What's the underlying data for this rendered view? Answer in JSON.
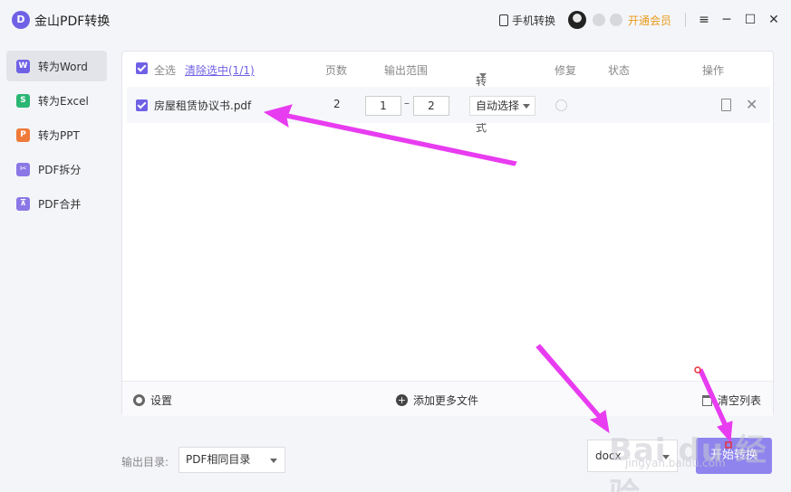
{
  "window": {
    "logo_letter": "D",
    "title": "金山PDF转换",
    "phone_convert": "手机转换",
    "vip_label": "开通会员",
    "menu_icon": "≡",
    "minimize_icon": "─",
    "maximize_icon": "☐",
    "close_icon": "✕"
  },
  "sidebar": {
    "items": [
      {
        "label": "转为Word",
        "icon": "W",
        "color": "#6f61e6",
        "active": true
      },
      {
        "label": "转为Excel",
        "icon": "S",
        "color": "#2bb673",
        "active": false
      },
      {
        "label": "转为PPT",
        "icon": "P",
        "color": "#f07a3a",
        "active": false
      },
      {
        "label": "PDF拆分",
        "icon": "✂",
        "color": "#8b78e6",
        "active": false
      },
      {
        "label": "PDF合并",
        "icon": "⊼",
        "color": "#8b78e6",
        "active": false
      }
    ]
  },
  "table": {
    "headers": {
      "select_all": "全选",
      "clear_selected": "清除选中(1/1)",
      "pages": "页数",
      "range": "输出范围",
      "mode": "转换模式",
      "repair": "修复",
      "status": "状态",
      "actions": "操作"
    },
    "rows": [
      {
        "filename": "房屋租赁协议书.pdf",
        "pages": "2",
        "range_from": "1",
        "range_sep": "–",
        "range_to": "2",
        "mode": "自动选择"
      }
    ]
  },
  "footer": {
    "settings": "设置",
    "add_more": "添加更多文件",
    "clear_list": "清空列表"
  },
  "bottom": {
    "output_dir_label": "输出目录:",
    "output_dir_value": "PDF相同目录",
    "format_value": "docx",
    "start_button": "开始转换"
  },
  "watermark": {
    "main": "Bai du 经验",
    "sub": "jingyan.baidu.com"
  },
  "colors": {
    "accent": "#6f61e6",
    "start_button": "#8f84ee",
    "annotation_arrow": "#e83cf0",
    "vip": "#e99a1b"
  }
}
